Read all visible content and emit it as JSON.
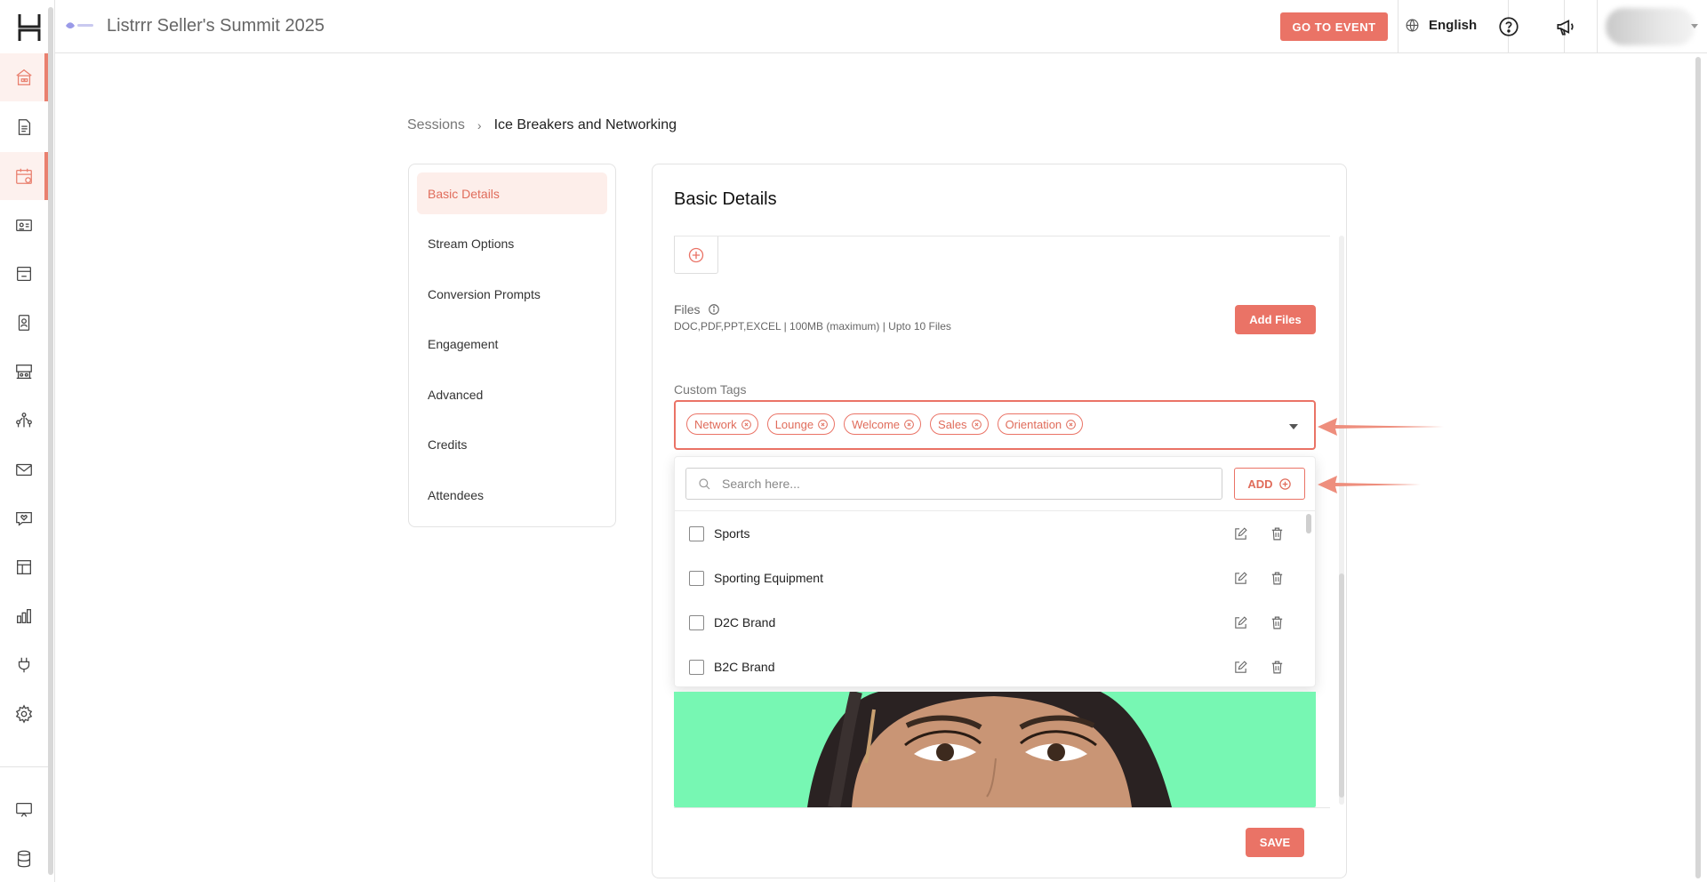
{
  "header": {
    "event_title": "Listrrr Seller's Summit 2025",
    "go_to_event_label": "GO TO EVENT",
    "language": "English"
  },
  "breadcrumb": {
    "parent": "Sessions",
    "current": "Ice Breakers and Networking"
  },
  "side_menu": {
    "items": [
      {
        "label": "Basic Details",
        "active": true
      },
      {
        "label": "Stream Options"
      },
      {
        "label": "Conversion Prompts"
      },
      {
        "label": "Engagement"
      },
      {
        "label": "Advanced"
      },
      {
        "label": "Credits"
      },
      {
        "label": "Attendees"
      }
    ]
  },
  "main": {
    "title": "Basic Details",
    "files": {
      "label": "Files",
      "hint": "DOC,PDF,PPT,EXCEL | 100MB (maximum) | Upto 10 Files",
      "add_label": "Add Files"
    },
    "custom_tags": {
      "label": "Custom Tags",
      "selected": [
        "Network",
        "Lounge",
        "Welcome",
        "Sales",
        "Orientation"
      ],
      "search_placeholder": "Search here...",
      "add_label": "ADD",
      "options": [
        "Sports",
        "Sporting Equipment",
        "D2C Brand",
        "B2C Brand"
      ]
    },
    "save_label": "SAVE"
  },
  "colors": {
    "accent": "#ea7366",
    "accent_light": "#fdeeea",
    "photo_background": "#77f7b3"
  },
  "icons": {
    "rail": [
      "home-icon",
      "document-icon",
      "calendar-icon",
      "id-card-icon",
      "layout-icon",
      "badge-icon",
      "booth-icon",
      "network-icon",
      "mail-icon",
      "chat-heart-icon",
      "table-layout-icon",
      "bar-chart-icon",
      "plug-icon",
      "gear-icon",
      "presentation-icon",
      "database-icon"
    ]
  }
}
